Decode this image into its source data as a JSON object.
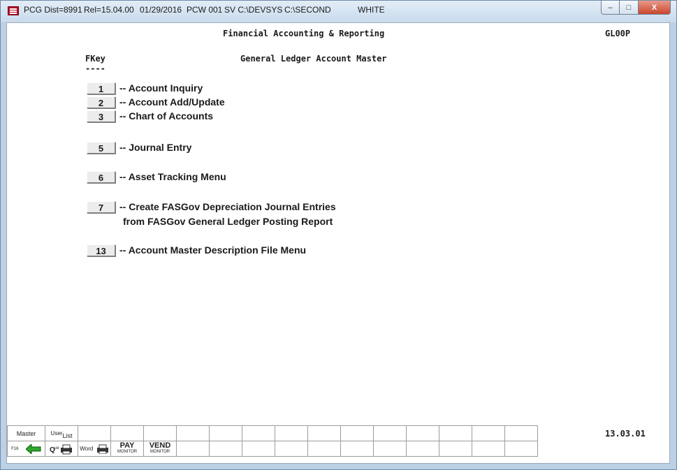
{
  "titlebar": {
    "segments": [
      "PCG Dist=8991",
      "Rel=15.04.00",
      "01/29/2016",
      "PCW 001",
      "SV C:\\DEVSYS",
      "C:\\SECOND",
      "WHITE"
    ],
    "window_buttons": {
      "minimize": "–",
      "maximize": "□",
      "close": "X"
    }
  },
  "screen": {
    "system_title": "Financial Accounting & Reporting",
    "screen_id": "GL00P",
    "fkey_header": "FKey",
    "fkey_underline": "----",
    "subtitle": "General Ledger Account Master",
    "version": "13.03.01"
  },
  "menu": [
    {
      "key": "1",
      "label": "--  Account Inquiry"
    },
    {
      "key": "2",
      "label": "--  Account Add/Update"
    },
    {
      "key": "3",
      "label": "--  Chart of Accounts"
    },
    {
      "key": "5",
      "label": "--  Journal Entry"
    },
    {
      "key": "6",
      "label": "--  Asset Tracking Menu"
    },
    {
      "key": "7",
      "label": "--  Create FASGov Depreciation Journal Entries",
      "label2": "from FASGov General Ledger Posting Report"
    },
    {
      "key": "13",
      "label": "--  Account Master Description File Menu"
    }
  ],
  "toolbar": {
    "master": "Master",
    "userlist_top": "User",
    "userlist_bottom": "List",
    "f16": "F16",
    "word": "Word",
    "pay_big": "PAY",
    "pay_small": "MONITOR",
    "vend_big": "VEND",
    "vend_small": "MONITOR"
  }
}
